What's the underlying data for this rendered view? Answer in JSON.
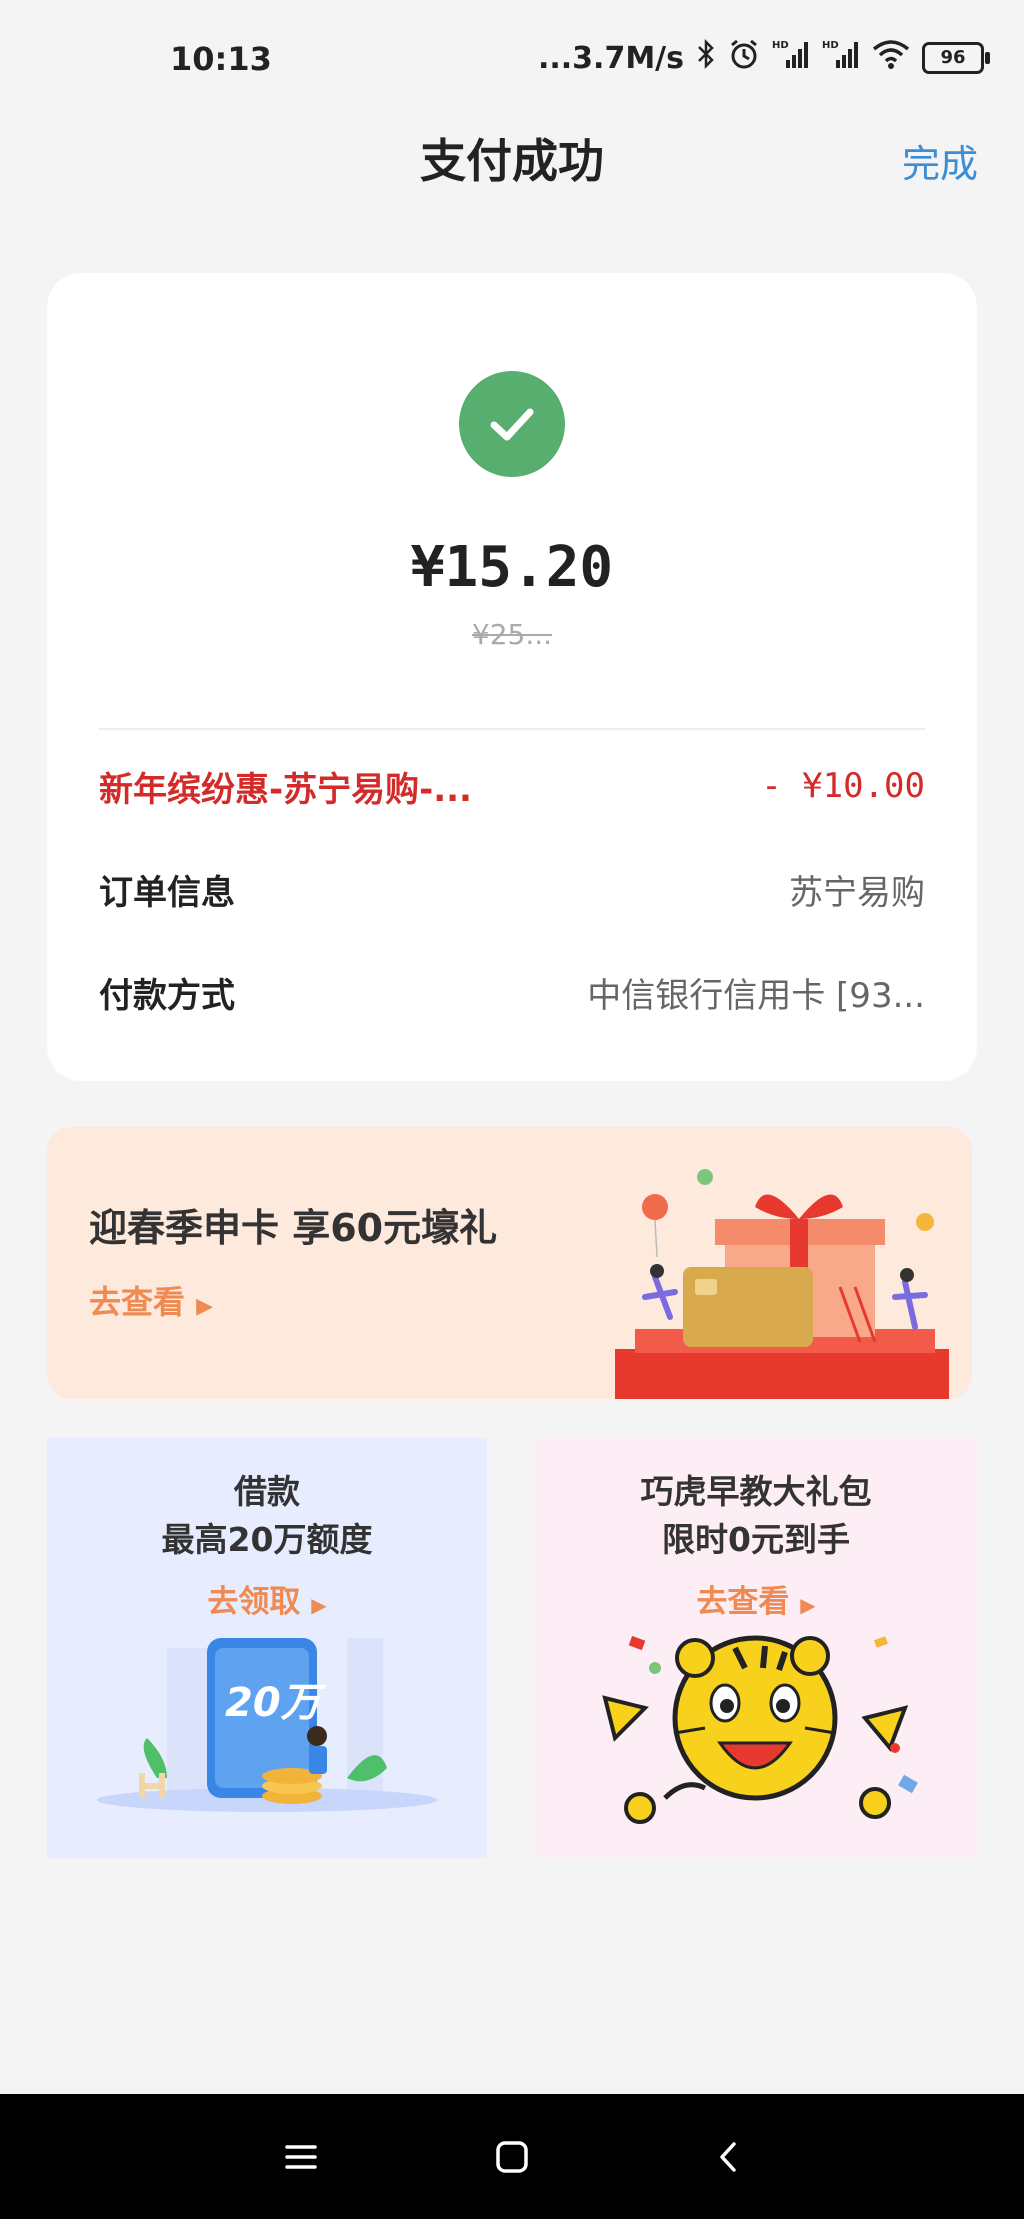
{
  "status_bar": {
    "time": "10:13",
    "network_speed": "...3.7M/s",
    "battery": "96",
    "icons": [
      "bluetooth-icon",
      "alarm-icon",
      "signal-hd-icon",
      "signal-hd-icon",
      "wifi-icon",
      "battery-icon"
    ]
  },
  "header": {
    "title": "支付成功",
    "done_label": "完成"
  },
  "payment": {
    "status_icon": "check-icon",
    "amount": "¥15.20",
    "original_amount": "¥25..."
  },
  "details": {
    "promo_label": "新年缤纷惠-苏宁易购-...",
    "promo_value": "- ¥10.00",
    "order_label": "订单信息",
    "order_value": "苏宁易购",
    "method_label": "付款方式",
    "method_value": "中信银行信用卡 [93..."
  },
  "banner": {
    "title": "迎春季申卡  享60元壕礼",
    "link": "去查看"
  },
  "promos": [
    {
      "title_line1": "借款",
      "title_line2": "最高20万额度",
      "link": "去领取",
      "badge": "20万"
    },
    {
      "title_line1": "巧虎早教大礼包",
      "title_line2": "限时0元到手",
      "link": "去查看"
    }
  ],
  "colors": {
    "accent_blue": "#3b8ed6",
    "success_green": "#58ae6e",
    "discount_red": "#d32a2a",
    "link_orange": "#ef8a52"
  }
}
